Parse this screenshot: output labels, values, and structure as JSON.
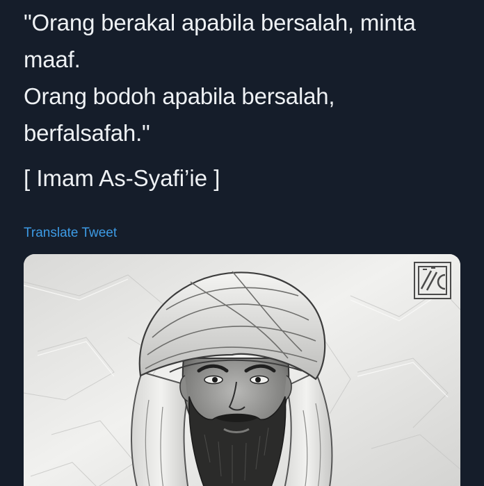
{
  "tweet": {
    "quote_lines": [
      "\"Orang berakal apabila bersalah, minta",
      "maaf.",
      "Orang bodoh apabila bersalah,",
      "berfalsafah.\""
    ],
    "attribution": "[ Imam As-Syafi’ie ]",
    "translate_label": "Translate Tweet"
  },
  "media": {
    "icon": "portrait-illustration",
    "watermark_icon": "logo-watermark-icon"
  },
  "colors": {
    "background": "#151d2a",
    "text": "#eef1f4",
    "link": "#3d9be5",
    "card_paper": "#e4e4e2"
  }
}
